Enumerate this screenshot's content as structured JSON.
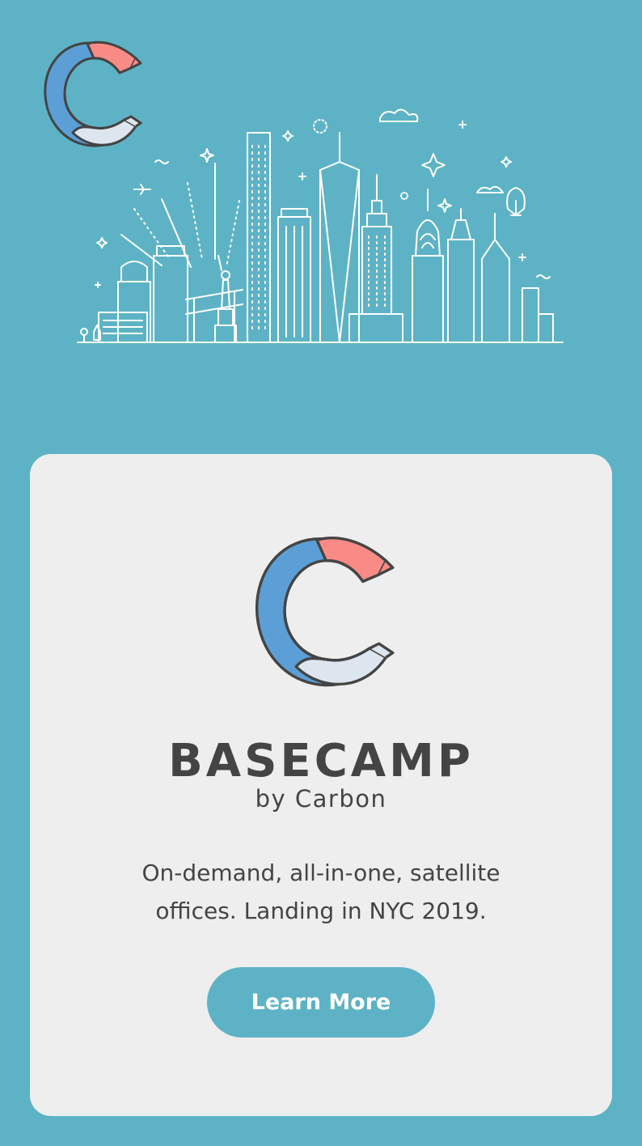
{
  "colors": {
    "page_background": "#5db3c5",
    "card_background": "#eeeeee",
    "text": "#444444",
    "logo_blue": "#5b9fd6",
    "logo_coral": "#f98b86",
    "logo_light": "#dde6ee",
    "button": "#5db3c5",
    "button_text": "#ffffff"
  },
  "header": {
    "logo_icon": "carbon-c-logo-icon",
    "illustration": "nyc-skyline-illustration"
  },
  "card": {
    "logo_icon": "carbon-c-logo-icon",
    "title": "BASECAMP",
    "subtitle": "by Carbon",
    "tagline_line1": "On-demand, all-in-one, satellite",
    "tagline_line2": "offices. Landing in NYC 2019.",
    "cta_label": "Learn More"
  }
}
